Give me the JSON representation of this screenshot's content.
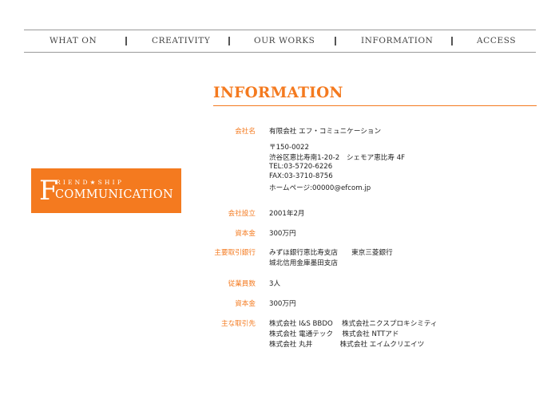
{
  "nav": {
    "items": [
      {
        "label": "WHAT ON"
      },
      {
        "label": "CREATIVITY"
      },
      {
        "label": "OUR WORKS"
      },
      {
        "label": "INFORMATION"
      },
      {
        "label": "ACCESS"
      }
    ]
  },
  "logo": {
    "initial": "F",
    "tagline": "RIEND★SHIP",
    "name": "COMMUNICATION"
  },
  "page": {
    "title": "INFORMATION"
  },
  "info": {
    "company_label": "会社名",
    "company_name": "有限会社 エフ・コミュニケーション",
    "postal": "〒150-0022",
    "address": "渋谷区恵比寿南1-20-2　シェモア恵比寿 4F",
    "tel": "TEL:03-5720-6226",
    "fax": "FAX:03-3710-8756",
    "homepage": "ホームページ:00000@efcom.jp",
    "established_label": "会社設立",
    "established": "2001年2月",
    "capital_label": "資本金",
    "capital": "300万円",
    "banks_label": "主要取引銀行",
    "banks_line1": "みずほ銀行恵比寿支店　　東京三菱銀行",
    "banks_line2": "城北信用金庫墨田支店",
    "employees_label": "従業員数",
    "employees": "3人",
    "capital2_label": "資本金",
    "capital2": "300万円",
    "clients_label": "主な取引先",
    "clients_line1": "株式会社 I&S BBDO　 株式会社ニクスプロキシミティ",
    "clients_line2": "株式会社 電通テック　 株式会社 NTTアド",
    "clients_line3": "株式会社 丸井　　　　株式会社 エイムクリエイツ"
  }
}
